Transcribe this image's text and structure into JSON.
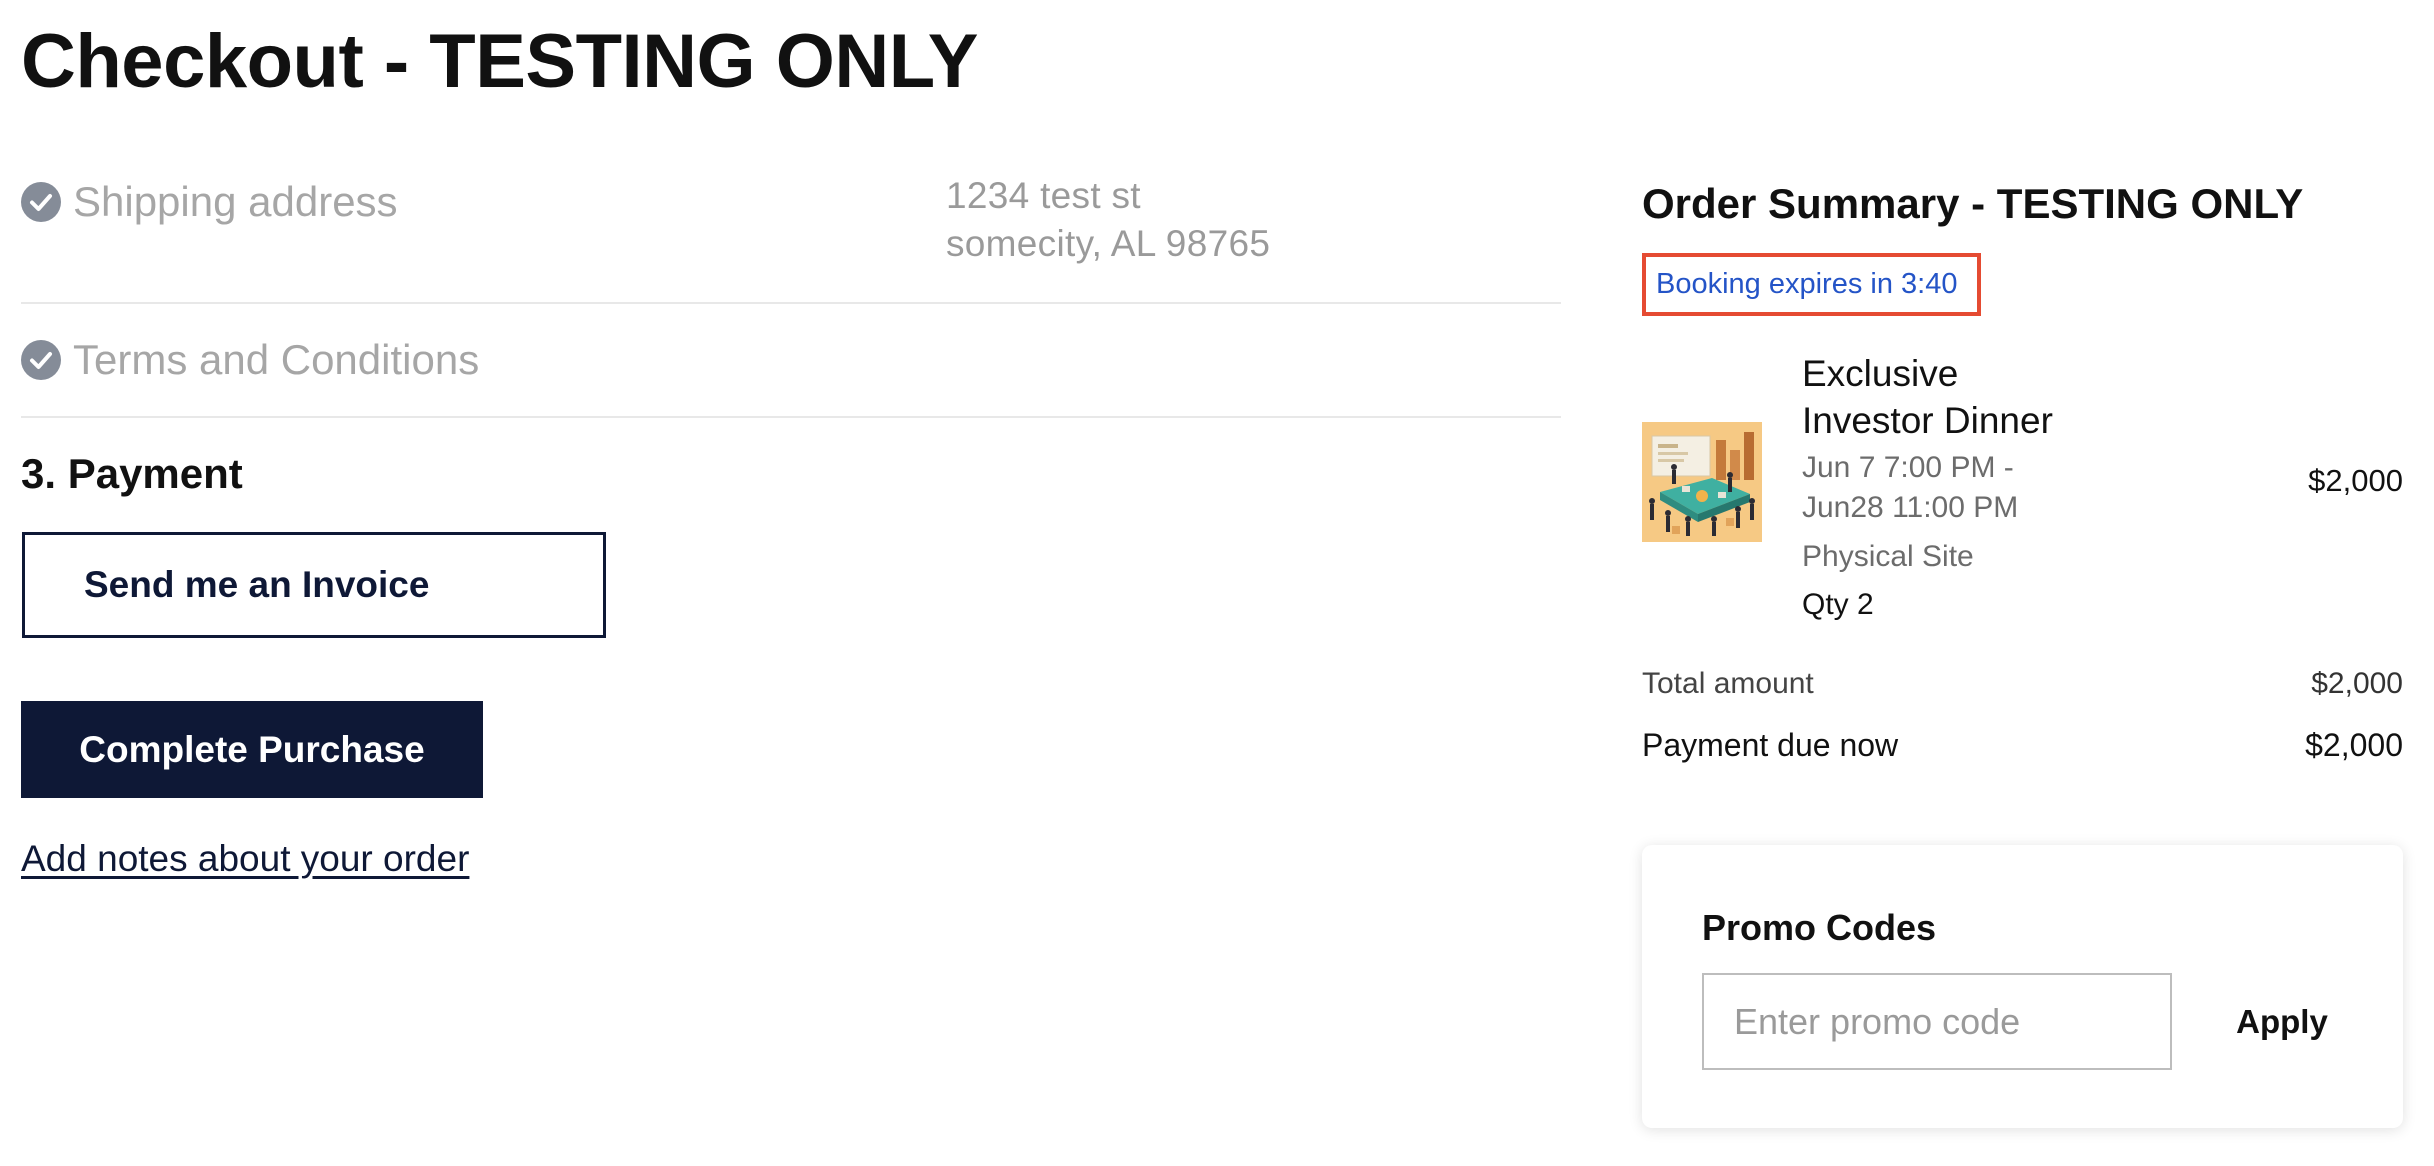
{
  "page": {
    "title": "Checkout - TESTING ONLY"
  },
  "steps": {
    "shipping": {
      "label": "Shipping address",
      "status": "complete",
      "address_line1": "1234 test st",
      "address_line2": "somecity, AL 98765"
    },
    "terms": {
      "label": "Terms and Conditions",
      "status": "complete"
    },
    "payment": {
      "heading": "3. Payment",
      "invoice_button": "Send me an Invoice",
      "complete_button": "Complete Purchase",
      "notes_link": "Add notes about your order"
    }
  },
  "summary": {
    "title": "Order Summary - TESTING ONLY",
    "timer_prefix": "Booking expires in ",
    "timer_value": "3:40",
    "timer_text": "Booking expires in 3:40",
    "item": {
      "name_line1": "Exclusive",
      "name_line2": "Investor Dinner",
      "dates_line1": "Jun 7 7:00 PM -",
      "dates_line2": "Jun28 11:00 PM",
      "location": "Physical Site",
      "quantity": "Qty 2",
      "price": "$2,000",
      "thumbnail_icon": "event-illustration"
    },
    "total_label": "Total amount",
    "total_value": "$2,000",
    "due_label": "Payment due now",
    "due_value": "$2,000"
  },
  "promo": {
    "title": "Promo Codes",
    "placeholder": "Enter promo code",
    "apply_label": "Apply"
  },
  "colors": {
    "primary": "#0e1836",
    "check_gray": "#858c98",
    "timer_border": "#e54b32",
    "timer_text": "#2454c7",
    "muted_text": "#a6a6a6"
  }
}
